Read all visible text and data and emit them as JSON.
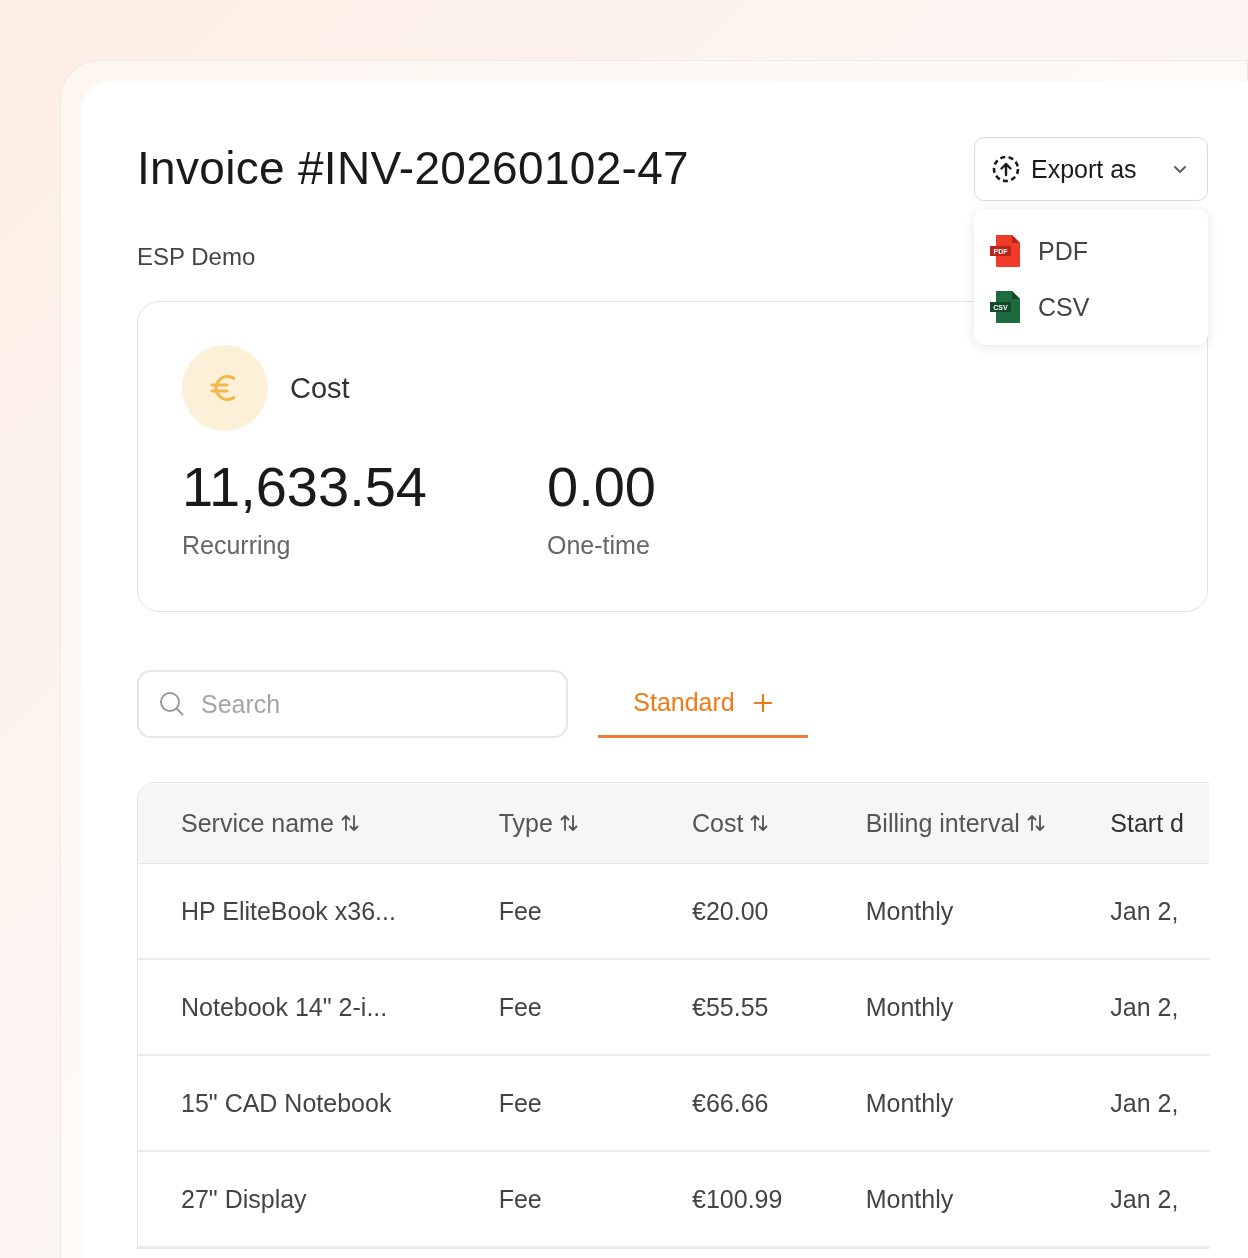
{
  "title": "Invoice #INV-20260102-47",
  "subtitle": "ESP Demo",
  "export": {
    "label": "Export as",
    "menu": [
      {
        "label": "PDF",
        "kind": "pdf",
        "badge": "PDF"
      },
      {
        "label": "CSV",
        "kind": "csv",
        "badge": "CSV"
      }
    ]
  },
  "cost_card": {
    "label": "Cost",
    "figures": [
      {
        "value": "11,633.54",
        "label": "Recurring"
      },
      {
        "value": "0.00",
        "label": "One-time"
      }
    ]
  },
  "search": {
    "placeholder": "Search"
  },
  "tabs": [
    {
      "label": "Standard",
      "selected": true
    }
  ],
  "table": {
    "columns": [
      {
        "label": "Service name",
        "sortable": true
      },
      {
        "label": "Type",
        "sortable": true
      },
      {
        "label": "Cost",
        "sortable": true
      },
      {
        "label": "Billing interval",
        "sortable": true
      },
      {
        "label": "Start d",
        "sortable": false
      }
    ],
    "rows": [
      [
        "HP EliteBook x36...",
        "Fee",
        "€20.00",
        "Monthly",
        "Jan 2,"
      ],
      [
        "Notebook 14\" 2-i...",
        "Fee",
        "€55.55",
        "Monthly",
        "Jan 2,"
      ],
      [
        "15\" CAD Notebook",
        "Fee",
        "€66.66",
        "Monthly",
        "Jan 2,"
      ],
      [
        "27\" Display",
        "Fee",
        "€100.99",
        "Monthly",
        "Jan 2,"
      ]
    ]
  }
}
